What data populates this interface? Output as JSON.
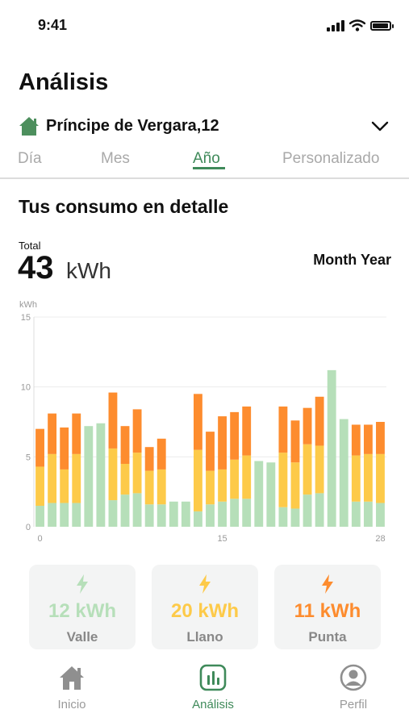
{
  "status_bar": {
    "time": "9:41"
  },
  "header": {
    "title": "Análisis"
  },
  "location": {
    "label": "Príncipe de Vergara,12"
  },
  "tabs": [
    {
      "label": "Día",
      "active": false
    },
    {
      "label": "Mes",
      "active": false
    },
    {
      "label": "Año",
      "active": true
    },
    {
      "label": "Personalizado",
      "active": false
    }
  ],
  "consumption": {
    "section_title": "Tus consumo en detalle",
    "total_label": "Total",
    "total_value": "43",
    "total_unit": "kWh",
    "period_label": "Month Year"
  },
  "colors": {
    "valle": "#b6dfb9",
    "llano": "#fdca49",
    "punta": "#fd8c2e",
    "accent": "#3f8a5a"
  },
  "chart_data": {
    "type": "bar",
    "stacked": true,
    "ylabel": "kWh",
    "ylim": [
      0,
      15
    ],
    "yticks": [
      0,
      5,
      10,
      15
    ],
    "xticks": [
      "0",
      "15",
      "28"
    ],
    "x": [
      0,
      1,
      2,
      3,
      4,
      5,
      6,
      7,
      8,
      9,
      10,
      11,
      12,
      13,
      14,
      15,
      16,
      17,
      18,
      19,
      20,
      21,
      22,
      23,
      24,
      25,
      26,
      27,
      28
    ],
    "grid": true,
    "series": [
      {
        "name": "Valle",
        "values": [
          1.5,
          1.7,
          1.7,
          1.7,
          7.2,
          7.4,
          1.9,
          2.3,
          2.4,
          1.6,
          1.6,
          1.8,
          1.8,
          1.1,
          1.6,
          1.8,
          2.0,
          2.0,
          4.7,
          4.6,
          1.4,
          1.3,
          2.3,
          2.4,
          11.2,
          7.7,
          1.8,
          1.8,
          1.7
        ]
      },
      {
        "name": "Llano",
        "values": [
          2.8,
          3.5,
          2.4,
          3.5,
          0,
          0,
          3.7,
          2.2,
          2.9,
          2.4,
          2.5,
          0,
          0,
          4.4,
          2.4,
          2.3,
          2.8,
          3.1,
          0,
          0,
          3.9,
          3.3,
          3.6,
          3.4,
          0,
          0,
          3.3,
          3.4,
          3.5
        ]
      },
      {
        "name": "Punta",
        "values": [
          2.7,
          2.9,
          3.0,
          2.9,
          0,
          0,
          4.0,
          2.7,
          3.1,
          1.7,
          2.2,
          0,
          0,
          4.0,
          2.8,
          3.8,
          3.4,
          3.5,
          0,
          0,
          3.3,
          3.0,
          2.6,
          3.5,
          0,
          0,
          2.2,
          2.1,
          2.3
        ]
      }
    ]
  },
  "summary_cards": [
    {
      "name": "valle",
      "icon": "bolt-icon",
      "value": "12 kWh",
      "label": "Valle",
      "color": "#b6dfb9"
    },
    {
      "name": "llano",
      "icon": "bolt-icon",
      "value": "20 kWh",
      "label": "Llano",
      "color": "#fdca49"
    },
    {
      "name": "punta",
      "icon": "bolt-icon",
      "value": "11 kWh",
      "label": "Punta",
      "color": "#fd8c2e"
    }
  ],
  "bottom_nav": [
    {
      "label": "Inicio",
      "icon": "home-icon",
      "active": false
    },
    {
      "label": "Análisis",
      "icon": "chart-icon",
      "active": true
    },
    {
      "label": "Perfil",
      "icon": "profile-icon",
      "active": false
    }
  ]
}
